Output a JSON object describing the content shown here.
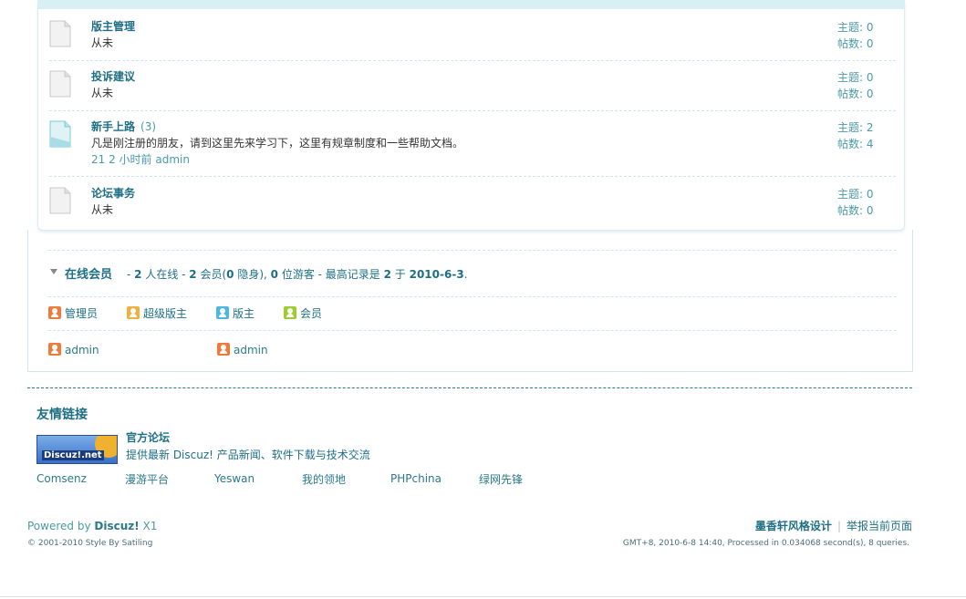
{
  "forums": [
    {
      "name": "版主管理",
      "count": "",
      "desc": "从未",
      "last": "",
      "topics": "主题: 0",
      "posts": "帖数: 0",
      "icon": "forum-old-icon"
    },
    {
      "name": "投诉建议",
      "count": "",
      "desc": "从未",
      "last": "",
      "topics": "主题: 0",
      "posts": "帖数: 0",
      "icon": "forum-old-icon"
    },
    {
      "name": "新手上路",
      "count": "(3)",
      "desc": "凡是刚注册的朋友，请到这里先来学习下，这里有规章制度和一些帮助文档。",
      "last": "21 2 小时前 admin",
      "topics": "主题: 2",
      "posts": "帖数: 4",
      "icon": "forum-new-icon"
    },
    {
      "name": "论坛事务",
      "count": "",
      "desc": "从未",
      "last": "",
      "topics": "主题: 0",
      "posts": "帖数: 0",
      "icon": "forum-old-icon"
    }
  ],
  "online": {
    "title": "在线会员",
    "info_parts": [
      "- ",
      "2",
      " 人在线  - ",
      "2",
      " 会员(",
      "0",
      " 隐身), ",
      "0",
      " 位游客  - 最高记录是  ",
      "2",
      " 于  ",
      "2010-6-3",
      "."
    ],
    "legend": [
      "管理员",
      "超级版主",
      "版主",
      "会员"
    ],
    "members": [
      "admin",
      "admin"
    ]
  },
  "links": {
    "title": "友情链接",
    "logo_text": "Discuz!.net",
    "official_name": "官方论坛",
    "official_desc": "提供最新 Discuz! 产品新闻、软件下载与技术交流",
    "text_links": [
      "Comsenz",
      "漫游平台",
      "Yeswan",
      "我的领地",
      "PHPchina",
      "绿网先锋"
    ]
  },
  "footer": {
    "powered_prefix": "Powered by ",
    "powered_brand": "Discuz!",
    "powered_version": " X1",
    "copyright": "© 2001-2010 Style By Satiling",
    "designer": "墨香轩风格设计",
    "report": "举报当前页面",
    "gmt": "GMT+8, 2010-6-8 14:40, Processed in 0.034068 second(s), 8 queries."
  },
  "colors": {
    "admin": "#f07a3a",
    "super_mod": "#f0b040",
    "mod": "#4ab8e0",
    "member": "#9ccc30"
  }
}
